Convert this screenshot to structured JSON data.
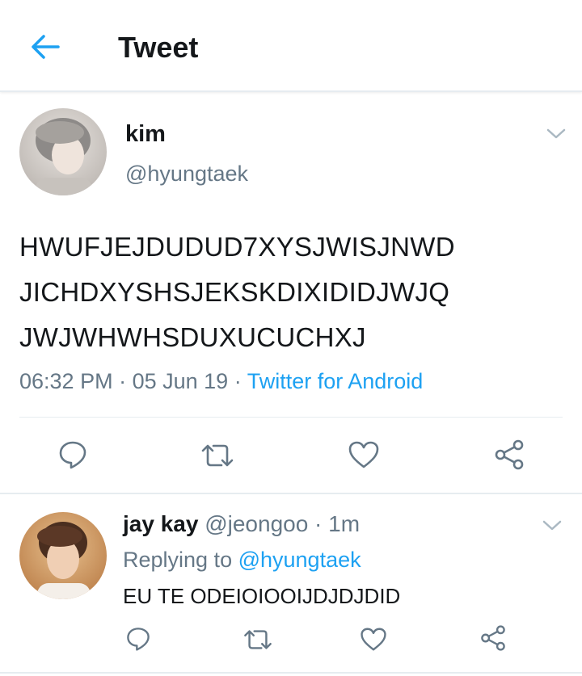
{
  "colors": {
    "accent": "#1da1f2",
    "muted": "#657786",
    "text": "#14171a",
    "divider": "#e6ecf0"
  },
  "header": {
    "title": "Tweet",
    "back_icon": "arrow-left-icon"
  },
  "tweet": {
    "display_name": "kim",
    "handle": "@hyungtaek",
    "text_lines": [
      "HWUFJEJDUDUD7XYSJWISJNWD",
      "JICHDXYSHSJEKSKDIXIDIDJWJQ",
      "JWJWHWHSDUXUCUCHXJ"
    ],
    "time": "06:32 PM",
    "sep1": " · ",
    "date": "05 Jun 19",
    "sep2": " · ",
    "source": "Twitter for Android",
    "actions": [
      "reply-icon",
      "retweet-icon",
      "like-icon",
      "share-icon"
    ]
  },
  "reply": {
    "display_name": "jay kay",
    "handle": "@jeongoo",
    "sep": " · ",
    "time": "1m",
    "replying_prefix": "Replying to ",
    "replying_to": "@hyungtaek",
    "text": "EU TE ODEIOIOOIJDJDJDID",
    "actions": [
      "reply-icon",
      "retweet-icon",
      "like-icon",
      "share-icon"
    ]
  }
}
